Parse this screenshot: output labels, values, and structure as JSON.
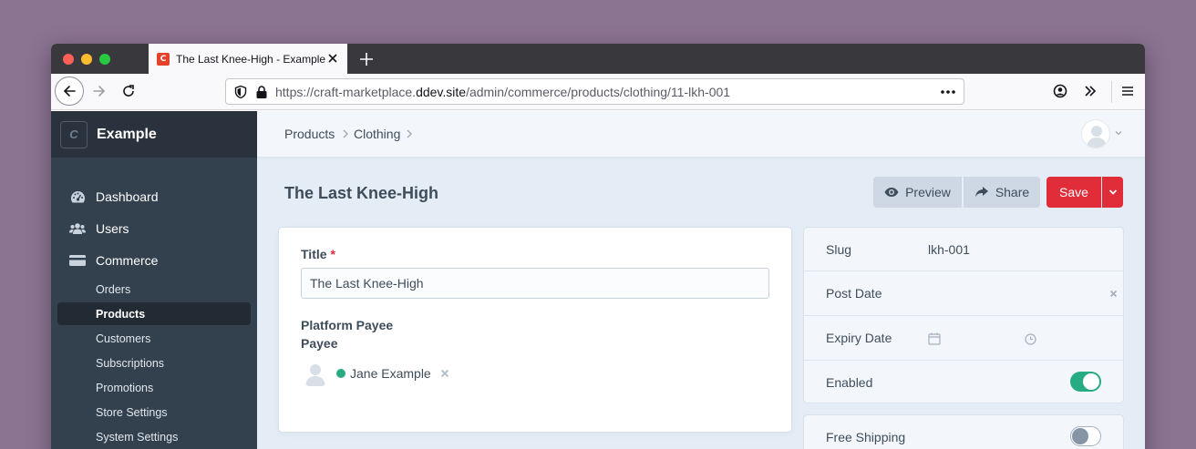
{
  "browser": {
    "tab_title": "The Last Knee-High - Example",
    "favicon_letter": "C",
    "url_prefix": "https://craft-marketplace.",
    "url_domain": "ddev.site",
    "url_path": "/admin/commerce/products/clothing/11-lkh-001"
  },
  "sidebar": {
    "logo_letter": "C",
    "site_name": "Example",
    "main_items": [
      {
        "label": "Dashboard",
        "icon": "gauge-icon"
      },
      {
        "label": "Users",
        "icon": "users-icon"
      },
      {
        "label": "Commerce",
        "icon": "credit-card-icon"
      }
    ],
    "sub_items": [
      {
        "label": "Orders",
        "active": false
      },
      {
        "label": "Products",
        "active": true
      },
      {
        "label": "Customers",
        "active": false
      },
      {
        "label": "Subscriptions",
        "active": false
      },
      {
        "label": "Promotions",
        "active": false
      },
      {
        "label": "Store Settings",
        "active": false
      },
      {
        "label": "System Settings",
        "active": false
      }
    ]
  },
  "breadcrumbs": [
    "Products",
    "Clothing"
  ],
  "page": {
    "title": "The Last Knee-High",
    "preview_label": "Preview",
    "share_label": "Share",
    "save_label": "Save"
  },
  "form": {
    "title_label": "Title",
    "required_mark": "*",
    "title_value": "The Last Knee-High",
    "platform_payee_label": "Platform Payee",
    "payee_label": "Payee",
    "payee_name": "Jane Example"
  },
  "meta": {
    "slug_label": "Slug",
    "slug_value": "lkh-001",
    "post_date_label": "Post Date",
    "expiry_date_label": "Expiry Date",
    "enabled_label": "Enabled",
    "enabled": true,
    "free_shipping_label": "Free Shipping",
    "free_shipping": false
  },
  "colors": {
    "accent_red": "#e12d39",
    "toggle_on": "#27ab83",
    "sidebar_bg": "#33404d"
  }
}
